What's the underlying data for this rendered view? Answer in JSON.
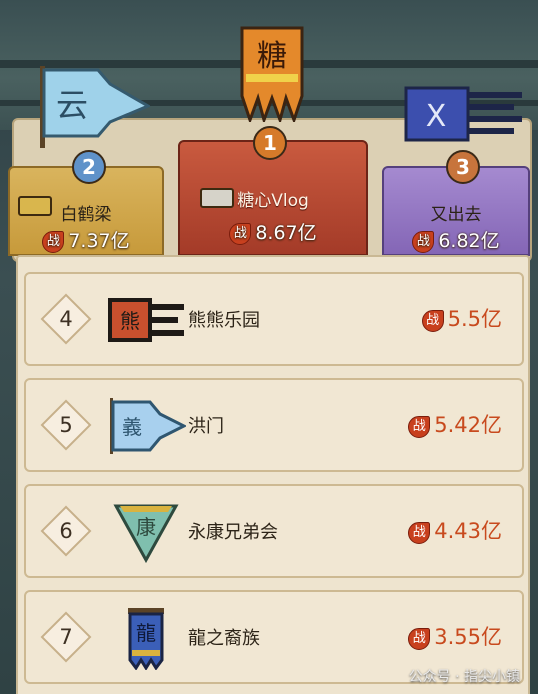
{
  "podium": [
    {
      "rank": "2",
      "name": "白鹤梁",
      "power_label": "战",
      "power": "7.37亿",
      "flag_char": "云",
      "flag_color": "#9fd2ea"
    },
    {
      "rank": "1",
      "name": "糖心Vlog",
      "power_label": "战",
      "power": "8.67亿",
      "flag_char": "糖",
      "flag_color": "#e4892b"
    },
    {
      "rank": "3",
      "name": "又出去",
      "power_label": "战",
      "power": "6.82亿",
      "flag_char": "X",
      "flag_color": "#3c4fae"
    }
  ],
  "list": [
    {
      "rank": "4",
      "name": "熊熊乐园",
      "power_label": "战",
      "power": "5.5亿",
      "emblem_char": "熊",
      "emblem_color": "#c8502e"
    },
    {
      "rank": "5",
      "name": "洪门",
      "power_label": "战",
      "power": "5.42亿",
      "emblem_char": "義",
      "emblem_color": "#a8d0ee"
    },
    {
      "rank": "6",
      "name": "永康兄弟会",
      "power_label": "战",
      "power": "4.43亿",
      "emblem_char": "康",
      "emblem_color": "#7fbfae"
    },
    {
      "rank": "7",
      "name": "龍之裔族",
      "power_label": "战",
      "power": "3.55亿",
      "emblem_char": "龍",
      "emblem_color": "#3b5fb8"
    }
  ],
  "watermark": "公众号 · 指尖小镇"
}
